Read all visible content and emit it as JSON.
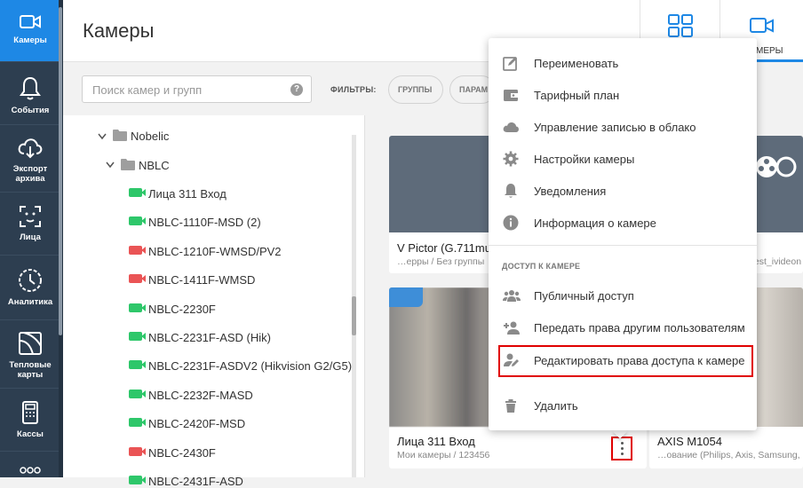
{
  "sidebar": {
    "items": [
      {
        "label": "Камеры",
        "icon": "camera-icon",
        "active": true
      },
      {
        "label": "События",
        "icon": "bell-icon"
      },
      {
        "label": "Экспорт архива",
        "icon": "cloud-download-icon"
      },
      {
        "label": "Лица",
        "icon": "face-scan-icon"
      },
      {
        "label": "Аналитика",
        "icon": "analytics-icon"
      },
      {
        "label": "Тепловые карты",
        "icon": "heatmap-icon"
      },
      {
        "label": "Кассы",
        "icon": "cash-register-icon"
      },
      {
        "label": "",
        "icon": "more-apps-icon"
      }
    ]
  },
  "header": {
    "title": "Камеры",
    "view_tabs": [
      {
        "icon": "grid-view-icon",
        "label": ""
      },
      {
        "icon": "camera-view-icon",
        "label": "МЕРЫ"
      }
    ]
  },
  "search": {
    "placeholder": "Поиск камер и групп",
    "help": "?"
  },
  "filters": {
    "label": "ФИЛЬТРЫ:",
    "chips": [
      "ГРУППЫ",
      "ПАРАМ"
    ]
  },
  "tree": {
    "folders": [
      {
        "name": "Nobelic"
      },
      {
        "name": "NBLC"
      }
    ],
    "cameras": [
      {
        "name": "Лица 311 Вход",
        "status": "online"
      },
      {
        "name": "NBLC-1110F-MSD (2)",
        "status": "online"
      },
      {
        "name": "NBLC-1210F-WMSD/PV2",
        "status": "offline"
      },
      {
        "name": "NBLC-1411F-WMSD",
        "status": "offline"
      },
      {
        "name": "NBLC-2230F",
        "status": "online"
      },
      {
        "name": "NBLC-2231F-ASD (Hik)",
        "status": "online"
      },
      {
        "name": "NBLC-2231F-ASDV2 (Hikvision G2/G5)",
        "status": "online"
      },
      {
        "name": "NBLC-2232F-MASD",
        "status": "online"
      },
      {
        "name": "NBLC-2420F-MSD",
        "status": "online"
      },
      {
        "name": "NBLC-2430F",
        "status": "offline"
      },
      {
        "name": "NBLC-2431F-ASD",
        "status": "online"
      }
    ]
  },
  "cards": [
    {
      "title": "V Pictor (G.711mu",
      "subtitle": "…ерры / Без группы"
    },
    {
      "title": "",
      "subtitle": "test_ivideon"
    },
    {
      "title": "Лица 311 Вход",
      "subtitle": "Мои камеры / 123456"
    },
    {
      "title": "AXIS M1054",
      "subtitle": "…ование (Philips, Axis, Samsung,"
    }
  ],
  "context_menu": {
    "items": [
      {
        "label": "Переименовать",
        "icon": "pencil-icon"
      },
      {
        "label": "Тарифный план",
        "icon": "wallet-icon"
      },
      {
        "label": "Управление записью в облако",
        "icon": "cloud-icon"
      },
      {
        "label": "Настройки камеры",
        "icon": "gear-icon"
      },
      {
        "label": "Уведомления",
        "icon": "bell-icon"
      },
      {
        "label": "Информация о камере",
        "icon": "info-icon"
      }
    ],
    "section_title": "ДОСТУП К КАМЕРЕ",
    "access_items": [
      {
        "label": "Публичный доступ",
        "icon": "people-icon"
      },
      {
        "label": "Передать права другим пользователям",
        "icon": "person-add-icon"
      },
      {
        "label": "Редактировать права доступа к камере",
        "icon": "person-edit-icon",
        "highlighted": true
      }
    ],
    "delete_label": "Удалить"
  },
  "colors": {
    "sidebar_bg": "#2d3e50",
    "accent": "#1e88e5",
    "online": "#2ec76a",
    "offline": "#ea5455",
    "highlight": "#e00000"
  }
}
